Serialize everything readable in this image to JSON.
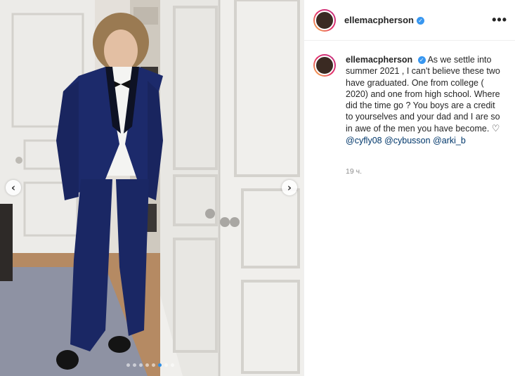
{
  "post": {
    "username": "ellemacpherson",
    "more_label": "•••",
    "caption": {
      "username": "ellemacpherson",
      "text": "As we settle into summer 2021 , I can't believe these two have graduated. One from college ( 2020) and one from high school. Where did the time go ? You boys are a credit to yourselves and your dad and I are so in awe of the men you have become.",
      "heart": "♡",
      "mentions": [
        "@cyfly08",
        "@cybusson",
        "@arki_b"
      ]
    },
    "timestamp": "19 ч.",
    "carousel": {
      "prev_icon": "chevron-left-icon",
      "next_icon": "chevron-right-icon",
      "prev_glyph": "‹",
      "next_glyph": "›",
      "total_slides": 8,
      "active_slide": 6
    }
  },
  "colors": {
    "link": "#00376b",
    "verified": "#3897f0",
    "active_dot": "#2f8fe6",
    "muted_text": "#8e8e8e",
    "suit": "#1c2a6b"
  }
}
